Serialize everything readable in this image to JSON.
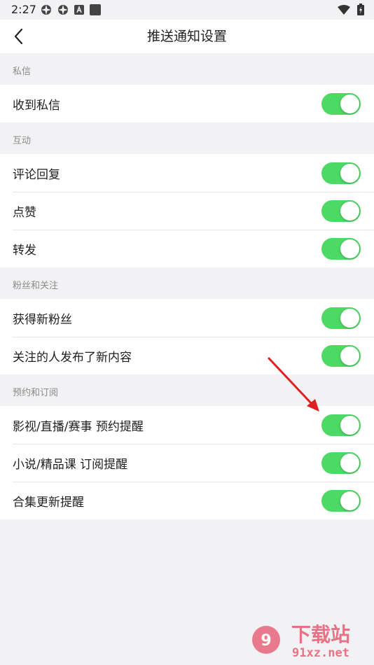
{
  "status_bar": {
    "time": "2:27",
    "icons": [
      "spinner-icon",
      "spinner-icon",
      "a-app-icon",
      "square-icon"
    ],
    "right_icons": [
      "wifi-icon",
      "battery-charging-icon"
    ]
  },
  "nav": {
    "title": "推送通知设置",
    "back_icon": "chevron-left-icon"
  },
  "sections": [
    {
      "header": "私信",
      "items": [
        {
          "label": "收到私信",
          "on": true
        }
      ]
    },
    {
      "header": "互动",
      "items": [
        {
          "label": "评论回复",
          "on": true
        },
        {
          "label": "点赞",
          "on": true
        },
        {
          "label": "转发",
          "on": true
        }
      ]
    },
    {
      "header": "粉丝和关注",
      "items": [
        {
          "label": "获得新粉丝",
          "on": true
        },
        {
          "label": "关注的人发布了新内容",
          "on": true
        }
      ]
    },
    {
      "header": "预约和订阅",
      "items": [
        {
          "label": "影视/直播/赛事 预约提醒",
          "on": true
        },
        {
          "label": "小说/精品课 订阅提醒",
          "on": true
        },
        {
          "label": "合集更新提醒",
          "on": true
        }
      ]
    }
  ],
  "colors": {
    "toggle_on": "#4cd964",
    "background": "#f2f2f4",
    "annotation_arrow": "#e02020"
  },
  "watermark": {
    "logo_text": "下载站",
    "site": "91xz.net"
  }
}
